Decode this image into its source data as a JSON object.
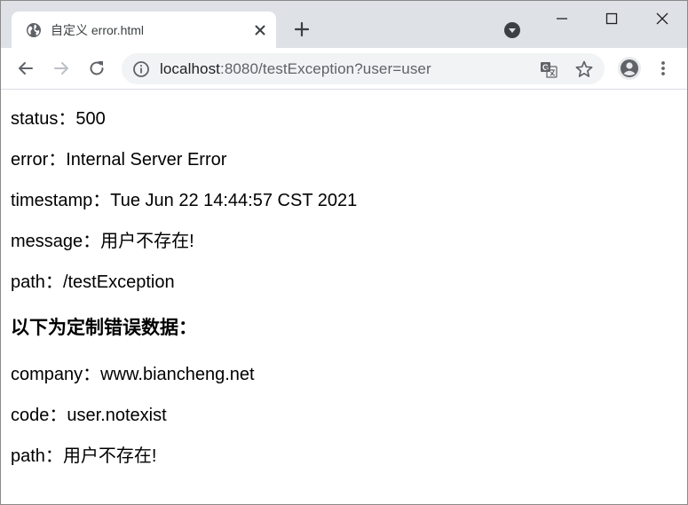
{
  "browser": {
    "tab_title": "自定义 error.html",
    "url_host": "localhost",
    "url_rest": ":8080/testException?user=user"
  },
  "content": {
    "lines": [
      {
        "label": "status：",
        "value": "500"
      },
      {
        "label": "error：",
        "value": "Internal Server Error"
      },
      {
        "label": "timestamp：",
        "value": "Tue Jun 22 14:44:57 CST 2021"
      },
      {
        "label": "message：",
        "value": "用户不存在!"
      },
      {
        "label": "path：",
        "value": "/testException"
      }
    ],
    "heading": "以下为定制错误数据：",
    "custom": [
      {
        "label": "company：",
        "value": "www.biancheng.net"
      },
      {
        "label": "code：",
        "value": "user.notexist"
      },
      {
        "label": "path：",
        "value": "用户不存在!"
      }
    ]
  }
}
